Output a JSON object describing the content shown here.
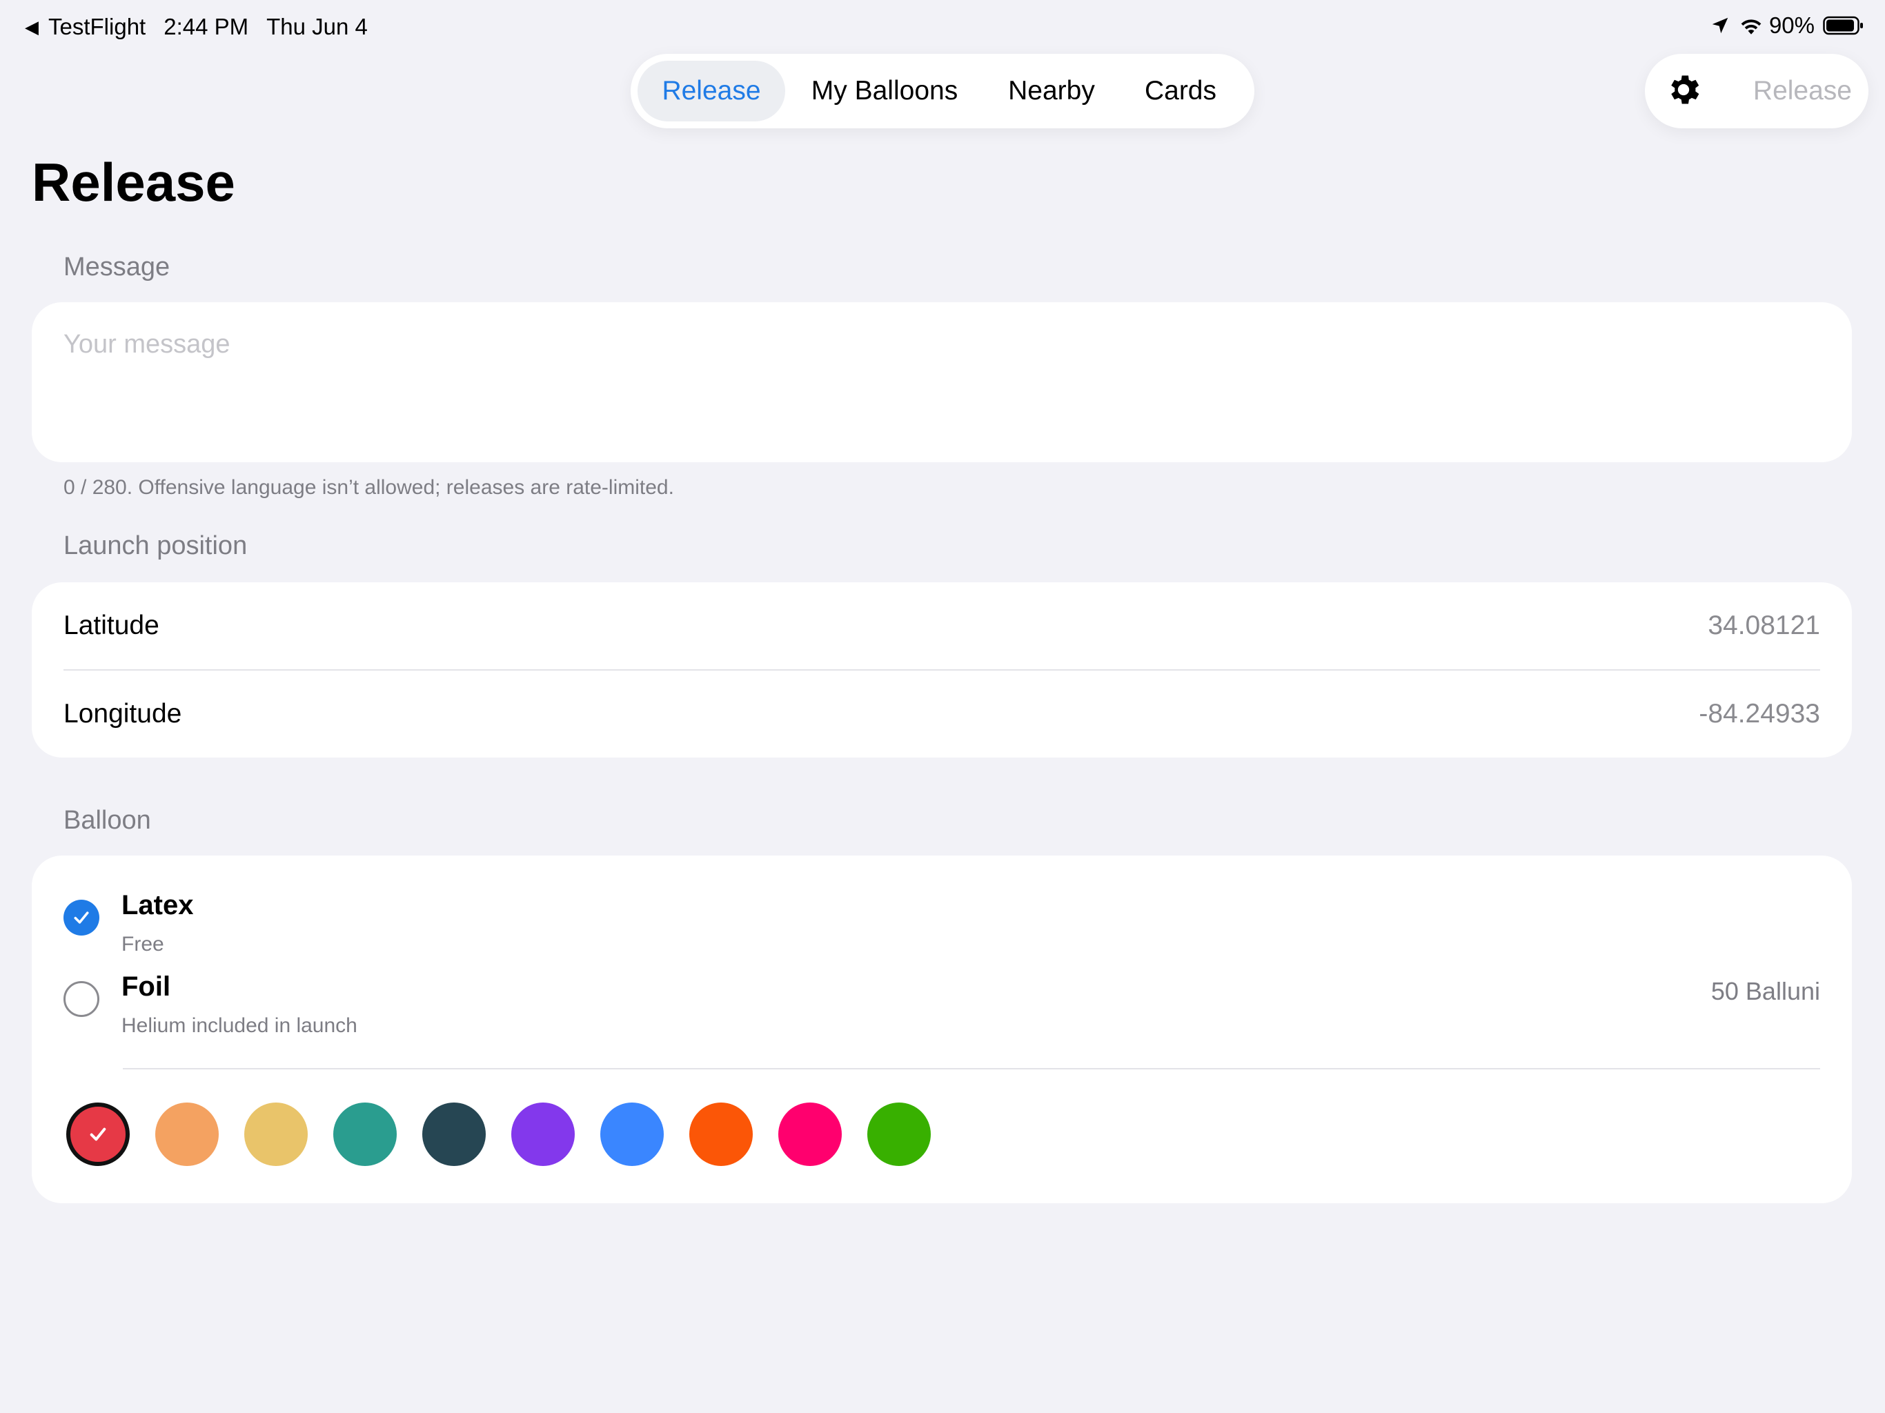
{
  "status_bar": {
    "back_app": "TestFlight",
    "time": "2:44 PM",
    "date": "Thu Jun 4",
    "battery": "90%",
    "icons": [
      "back-triangle-icon",
      "location-arrow-icon",
      "wifi-icon",
      "battery-icon"
    ]
  },
  "tabs": [
    {
      "label": "Release",
      "active": true
    },
    {
      "label": "My Balloons",
      "active": false
    },
    {
      "label": "Nearby",
      "active": false
    },
    {
      "label": "Cards",
      "active": false
    }
  ],
  "toolbar": {
    "settings_icon": "gear-icon",
    "release_label": "Release",
    "release_enabled": false
  },
  "page": {
    "title": "Release"
  },
  "message": {
    "section_label": "Message",
    "placeholder": "Your message",
    "value": "",
    "help_text": "0 / 280. Offensive language isn’t allowed; releases are rate-limited."
  },
  "launch_position": {
    "section_label": "Launch position",
    "latitude_label": "Latitude",
    "latitude_value": "34.08121",
    "longitude_label": "Longitude",
    "longitude_value": "-84.24933"
  },
  "balloon": {
    "section_label": "Balloon",
    "options": [
      {
        "title": "Latex",
        "subtitle": "Free",
        "price": "",
        "selected": true
      },
      {
        "title": "Foil",
        "subtitle": "Helium included in launch",
        "price": "50 Balluni",
        "selected": false
      }
    ],
    "colors": [
      {
        "hex": "#e63946",
        "selected": true
      },
      {
        "hex": "#f4a261",
        "selected": false
      },
      {
        "hex": "#e9c46a",
        "selected": false
      },
      {
        "hex": "#2a9d8f",
        "selected": false
      },
      {
        "hex": "#264653",
        "selected": false
      },
      {
        "hex": "#8338ec",
        "selected": false
      },
      {
        "hex": "#3a86ff",
        "selected": false
      },
      {
        "hex": "#fb5607",
        "selected": false
      },
      {
        "hex": "#ff006e",
        "selected": false
      },
      {
        "hex": "#38b000",
        "selected": false
      }
    ]
  },
  "theme": {
    "accent": "#1f7be6",
    "background": "#f2f2f7",
    "secondary_text": "#7d7d84"
  }
}
